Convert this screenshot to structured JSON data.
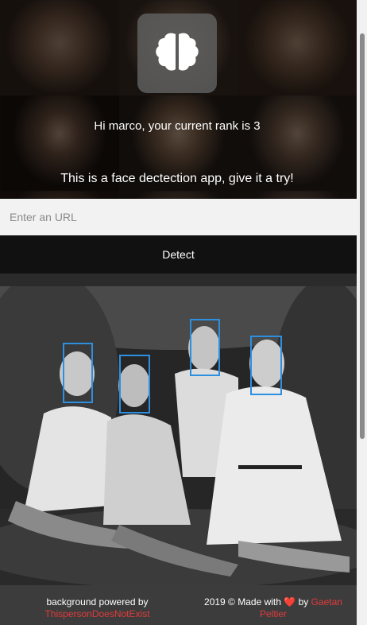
{
  "app": {
    "greeting": "Hi marco, your current rank is 3",
    "tagline": "This is a face dectection app, give it a try!",
    "logo_icon": "brain-icon"
  },
  "form": {
    "url_placeholder": "Enter an URL",
    "url_value": "",
    "detect_label": "Detect"
  },
  "result": {
    "faces_detected": 4,
    "box_color": "#2d8fe0"
  },
  "footer": {
    "left_text": "background powered by",
    "left_link": "ThispersonDoesNotExist",
    "right_text": "2019 © Made with",
    "heart": "❤️",
    "by": "by",
    "author_link": "Gaetan Peltier",
    "link_color": "#e23b3b"
  }
}
